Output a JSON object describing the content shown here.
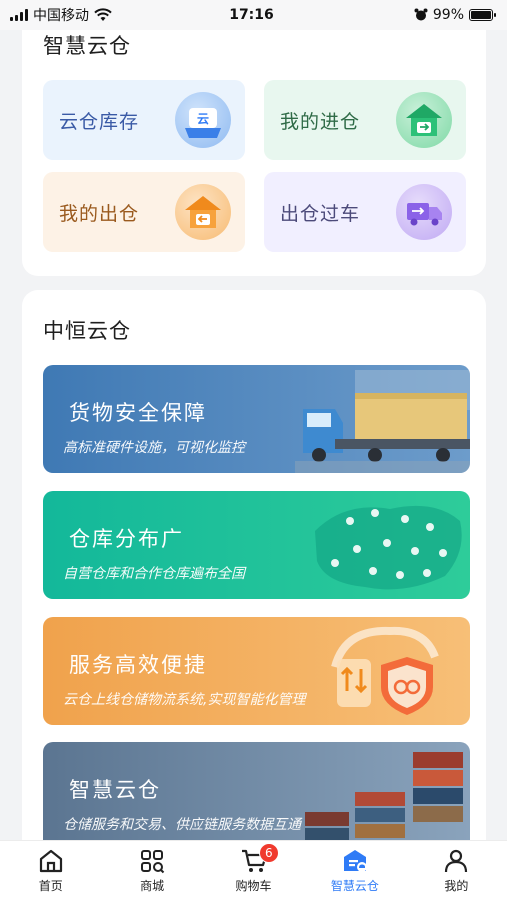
{
  "status_bar": {
    "carrier": "中国移动",
    "time": "17:16",
    "battery": "99%",
    "battery_level": 0.99
  },
  "smart_warehouse": {
    "title": "智慧云仓",
    "tiles": [
      {
        "label": "云仓库存",
        "icon": "cloud-inventory-icon",
        "icon_text": "云",
        "color": "#3a5aa6",
        "bg": "#eaf3fd"
      },
      {
        "label": "我的进仓",
        "icon": "inbound-warehouse-icon",
        "color": "#2f6b47",
        "bg": "#e8f7ef"
      },
      {
        "label": "我的出仓",
        "icon": "outbound-warehouse-icon",
        "color": "#9a5a1e",
        "bg": "#fdf2e6"
      },
      {
        "label": "出仓过车",
        "icon": "truck-icon",
        "color": "#4c4a7a",
        "bg": "#f1efff"
      }
    ]
  },
  "zhongheng": {
    "title": "中恒云仓",
    "banners": [
      {
        "title": "货物安全保障",
        "subtitle": "高标准硬件设施，可视化监控",
        "colors": [
          "#3f79b4",
          "#6d9ccb"
        ]
      },
      {
        "title": "仓库分布广",
        "subtitle": "自营仓库和合作仓库遍布全国",
        "colors": [
          "#13b89a",
          "#2ecc9a"
        ]
      },
      {
        "title": "服务高效便捷",
        "subtitle": "云仓上线仓储物流系统,实现智能化管理",
        "colors": [
          "#f0a24c",
          "#f7bf77"
        ]
      },
      {
        "title": "智慧云仓",
        "subtitle": "仓储服务和交易、供应链服务数据互通",
        "colors": [
          "#5b7591",
          "#8aa3bc"
        ]
      }
    ]
  },
  "tabbar": {
    "accent": "#2f7bf6",
    "items": [
      {
        "label": "首页",
        "icon": "home-icon"
      },
      {
        "label": "商城",
        "icon": "grid-icon"
      },
      {
        "label": "购物车",
        "icon": "cart-icon",
        "badge": "6"
      },
      {
        "label": "智慧云仓",
        "icon": "smart-warehouse-icon",
        "active": true
      },
      {
        "label": "我的",
        "icon": "user-icon"
      }
    ]
  }
}
